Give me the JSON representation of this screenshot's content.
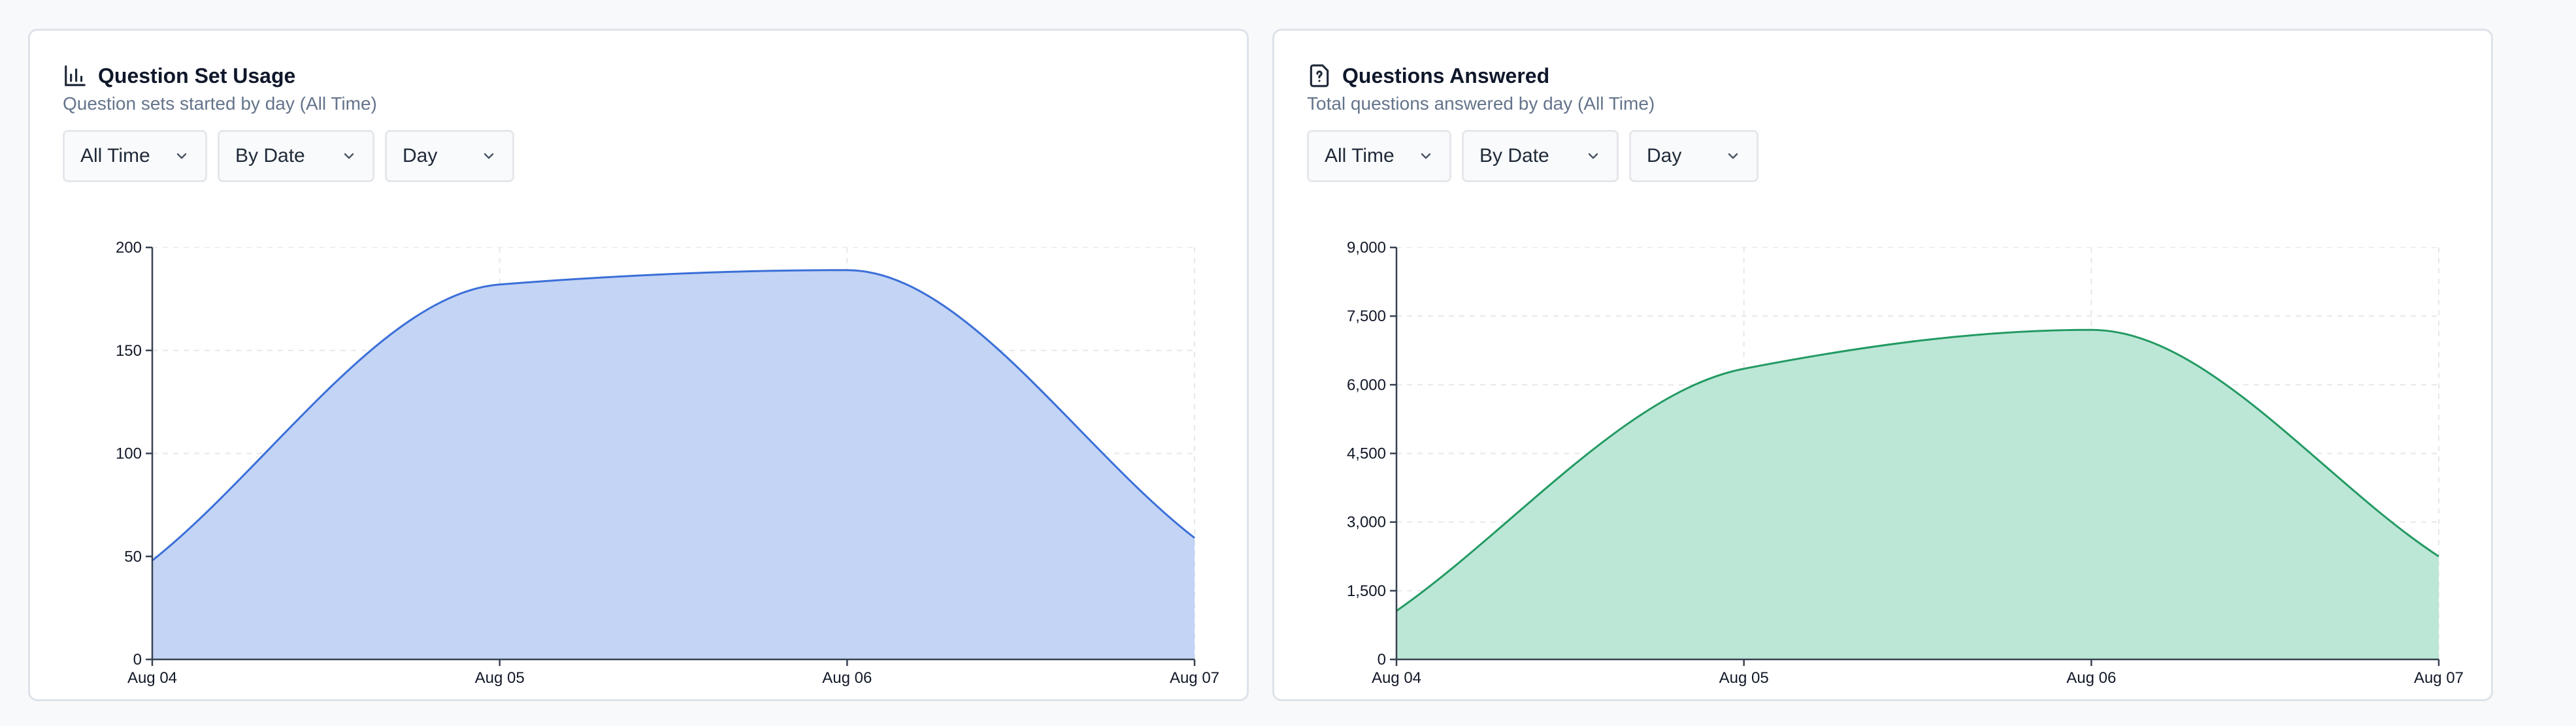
{
  "cards": [
    {
      "title": "Question Set Usage",
      "subtitle": "Question sets started by day (All Time)",
      "filters": {
        "range": "All Time",
        "group": "By Date",
        "interval": "Day"
      },
      "icon": "bar-chart-icon"
    },
    {
      "title": "Questions Answered",
      "subtitle": "Total questions answered by day (All Time)",
      "filters": {
        "range": "All Time",
        "group": "By Date",
        "interval": "Day"
      },
      "icon": "question-file-icon"
    }
  ],
  "chart_data": [
    {
      "type": "area",
      "x": [
        "Aug 04",
        "Aug 05",
        "Aug 06",
        "Aug 07"
      ],
      "series": [
        {
          "values": [
            48,
            182,
            189,
            59
          ]
        }
      ],
      "ylim": [
        0,
        200
      ],
      "yticks": [
        0,
        50,
        100,
        150,
        200
      ],
      "ytick_labels": [
        "0",
        "50",
        "100",
        "150",
        "200"
      ],
      "grid": true,
      "colors": {
        "stroke": "#3b6fd8",
        "fill": "#c3d4f5"
      }
    },
    {
      "type": "area",
      "x": [
        "Aug 04",
        "Aug 05",
        "Aug 06",
        "Aug 07"
      ],
      "series": [
        {
          "values": [
            1060,
            6350,
            7200,
            2250
          ]
        }
      ],
      "ylim": [
        0,
        9000
      ],
      "yticks": [
        0,
        1500,
        3000,
        4500,
        6000,
        7500,
        9000
      ],
      "ytick_labels": [
        "0",
        "1,500",
        "3,000",
        "4,500",
        "6,000",
        "7,500",
        "9,000"
      ],
      "grid": true,
      "colors": {
        "stroke": "#239a63",
        "fill": "#bce7d6"
      }
    }
  ]
}
